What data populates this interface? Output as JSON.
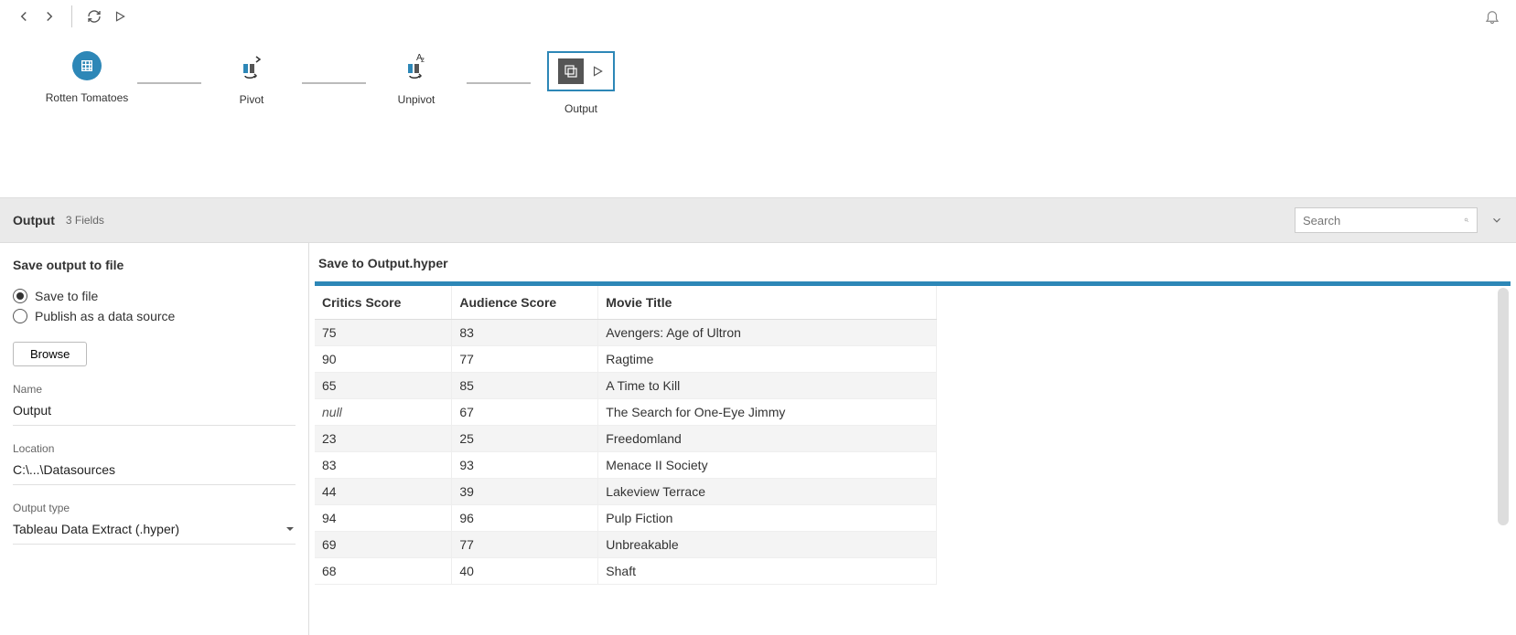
{
  "toolbar": {},
  "flow": {
    "nodes": [
      {
        "label": "Rotten Tomatoes",
        "type": "input"
      },
      {
        "label": "Pivot",
        "type": "pivot"
      },
      {
        "label": "Unpivot",
        "type": "unpivot"
      },
      {
        "label": "Output",
        "type": "output"
      }
    ]
  },
  "paneHeader": {
    "title": "Output",
    "subtitle": "3 Fields",
    "searchPlaceholder": "Search"
  },
  "leftPanel": {
    "heading": "Save output to file",
    "radioSaveToFile": "Save to file",
    "radioPublish": "Publish as a data source",
    "browse": "Browse",
    "nameLabel": "Name",
    "nameValue": "Output",
    "locationLabel": "Location",
    "locationValue": "C:\\...\\Datasources",
    "outputTypeLabel": "Output type",
    "outputTypeValue": "Tableau Data Extract (.hyper)"
  },
  "rightPanel": {
    "heading": "Save to Output.hyper",
    "columns": [
      "Critics Score",
      "Audience Score",
      "Movie Title"
    ],
    "rows": [
      {
        "critics": "75",
        "audience": "83",
        "title": "Avengers: Age of Ultron"
      },
      {
        "critics": "90",
        "audience": "77",
        "title": "Ragtime"
      },
      {
        "critics": "65",
        "audience": "85",
        "title": "A Time to Kill"
      },
      {
        "critics": null,
        "audience": "67",
        "title": "The Search for One-Eye Jimmy"
      },
      {
        "critics": "23",
        "audience": "25",
        "title": "Freedomland"
      },
      {
        "critics": "83",
        "audience": "93",
        "title": "Menace II Society"
      },
      {
        "critics": "44",
        "audience": "39",
        "title": "Lakeview Terrace"
      },
      {
        "critics": "94",
        "audience": "96",
        "title": "Pulp Fiction"
      },
      {
        "critics": "69",
        "audience": "77",
        "title": "Unbreakable"
      },
      {
        "critics": "68",
        "audience": "40",
        "title": "Shaft"
      }
    ],
    "nullText": "null"
  }
}
